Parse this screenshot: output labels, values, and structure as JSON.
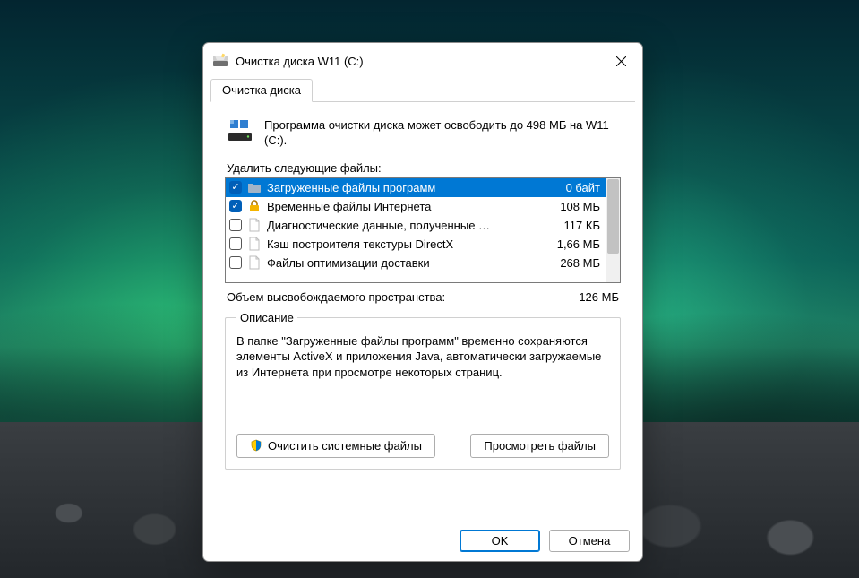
{
  "titlebar": {
    "title": "Очистка диска W11 (C:)"
  },
  "tabs": [
    {
      "label": "Очистка диска"
    }
  ],
  "intro": "Программа очистки диска может освободить до 498 МБ на W11 (C:).",
  "files_label": "Удалить следующие файлы:",
  "files": [
    {
      "checked": true,
      "name": "Загруженные файлы программ",
      "size": "0 байт",
      "icon": "folder",
      "selected": true
    },
    {
      "checked": true,
      "name": "Временные файлы Интернета",
      "size": "108 МБ",
      "icon": "lock"
    },
    {
      "checked": false,
      "name": "Диагностические данные, полученные …",
      "size": "117 КБ",
      "icon": "file"
    },
    {
      "checked": false,
      "name": "Кэш построителя текстуры DirectX",
      "size": "1,66 МБ",
      "icon": "file"
    },
    {
      "checked": false,
      "name": "Файлы оптимизации доставки",
      "size": "268 МБ",
      "icon": "file"
    }
  ],
  "total": {
    "label": "Объем высвобождаемого пространства:",
    "value": "126 МБ"
  },
  "fieldset": {
    "legend": "Описание",
    "text": "В папке \"Загруженные файлы программ\" временно сохраняются элементы ActiveX и приложения Java, автоматически загружаемые из Интернета при просмотре некоторых страниц."
  },
  "buttons": {
    "clean_system": "Очистить системные файлы",
    "view_files": "Просмотреть файлы",
    "ok": "OK",
    "cancel": "Отмена"
  }
}
